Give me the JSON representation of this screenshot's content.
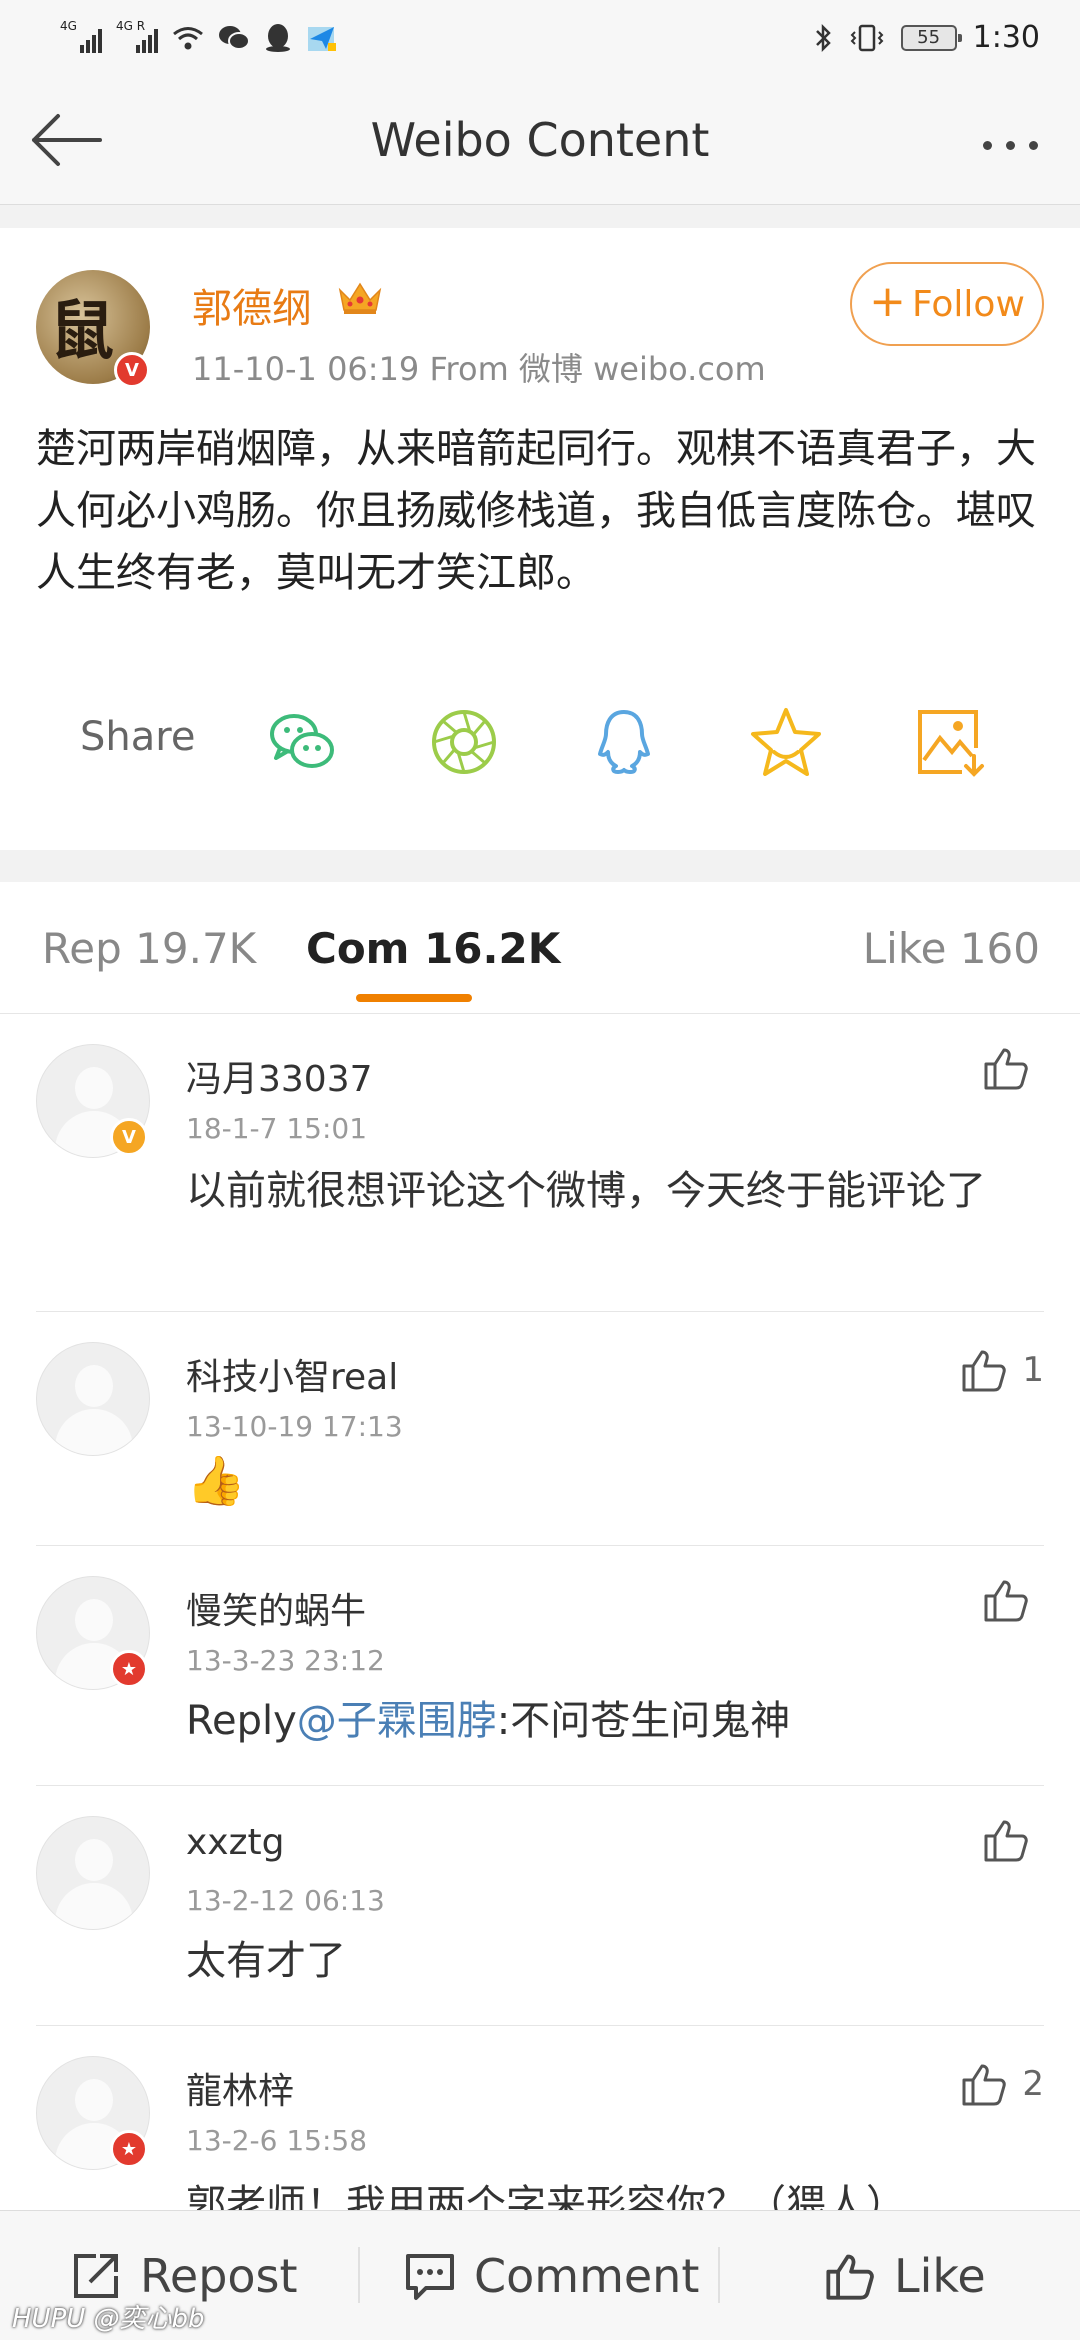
{
  "status_bar": {
    "net1": "4G",
    "net2": "4G R",
    "battery": "55",
    "time": "1:30"
  },
  "nav": {
    "title": "Weibo Content"
  },
  "post": {
    "author": "郭德纲",
    "meta": "11-10-1 06:19   From 微博 weibo.com",
    "follow_label": "Follow",
    "text": "楚河两岸硝烟障，从来暗箭起同行。观棋不语真君子，大人何必小鸡肠。你且扬威修栈道，我自低言度陈仓。堪叹人生终有老，莫叫无才笑江郎。",
    "share_label": "Share"
  },
  "tabs": {
    "repost": "Rep 19.7K",
    "comments": "Com 16.2K",
    "likes": "Like 160"
  },
  "comments": [
    {
      "name": "冯月33037",
      "time": "18-1-7 15:01",
      "text": "以前就很想评论这个微博，今天终于能评论了",
      "likes": ""
    },
    {
      "name": "科技小智real",
      "time": "13-10-19 17:13",
      "text": "👍",
      "likes": "1"
    },
    {
      "name": "慢笑的蜗牛",
      "time": "13-3-23 23:12",
      "reply_prefix": "Reply",
      "mention": "@子霖围脖",
      "reply_text": ":不问苍生问鬼神",
      "likes": ""
    },
    {
      "name": "xxztg",
      "time": "13-2-12 06:13",
      "text": "太有才了",
      "likes": ""
    },
    {
      "name": "龍林梓",
      "time": "13-2-6 15:58",
      "text": "郭老师！我用两个字来形容你？（猥人）",
      "likes": "2"
    }
  ],
  "toolbar": {
    "repost": "Repost",
    "comment": "Comment",
    "like": "Like"
  },
  "watermark": "HUPU @奕心bb",
  "colors": {
    "accent": "#f08000",
    "author_name": "#e87b14",
    "mention": "#4a7fb5"
  }
}
